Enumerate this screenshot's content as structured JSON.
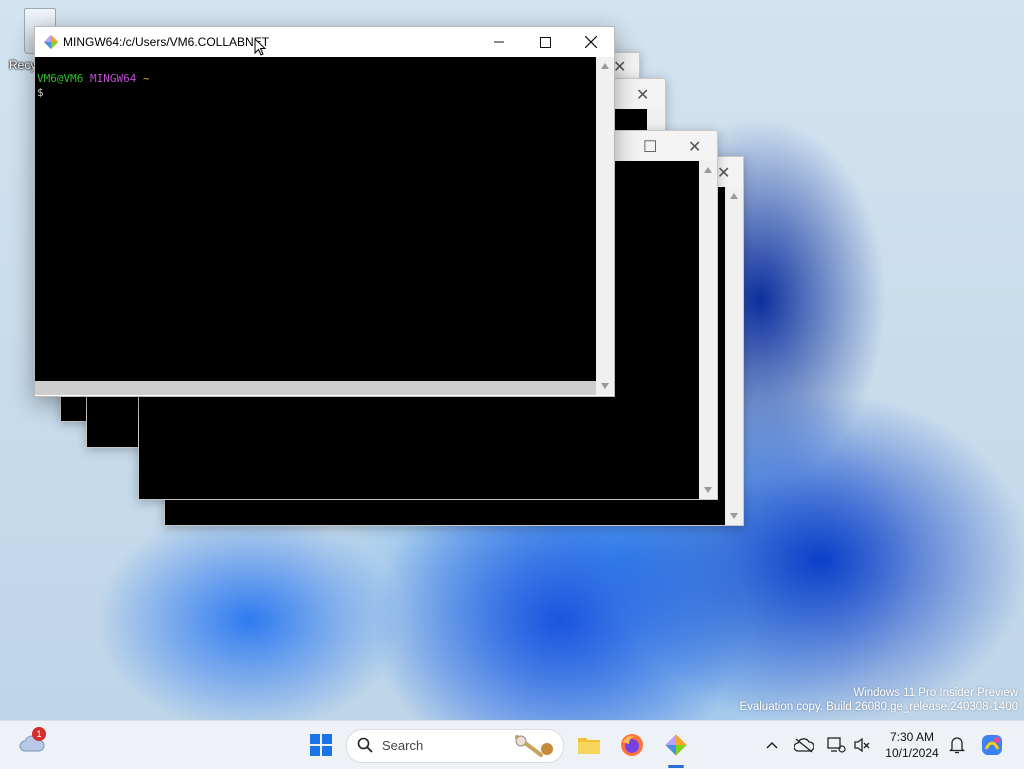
{
  "desktop": {
    "recycle_bin_label": "Recy"
  },
  "main_window": {
    "title": "MINGW64:/c/Users/VM6.COLLABNET",
    "prompt_user": "VM6@VM6",
    "prompt_shell": "MINGW64",
    "prompt_path": "~",
    "prompt_symbol": "$",
    "minimize_icon": "minimize-icon",
    "maximize_icon": "maximize-icon",
    "close_icon": "close-icon"
  },
  "watermark": {
    "line1": "Windows 11 Pro Insider Preview",
    "line2": "Evaluation copy. Build 26080.ge_release.240308-1400"
  },
  "taskbar": {
    "weather_badge": "1",
    "search_placeholder": "Search",
    "time": "7:30 AM",
    "date": "10/1/2024"
  },
  "colors": {
    "prompt_user": "#2fbf2f",
    "prompt_shell": "#c14cd1",
    "prompt_path": "#c7b32a",
    "accent": "#2b6cd8"
  }
}
